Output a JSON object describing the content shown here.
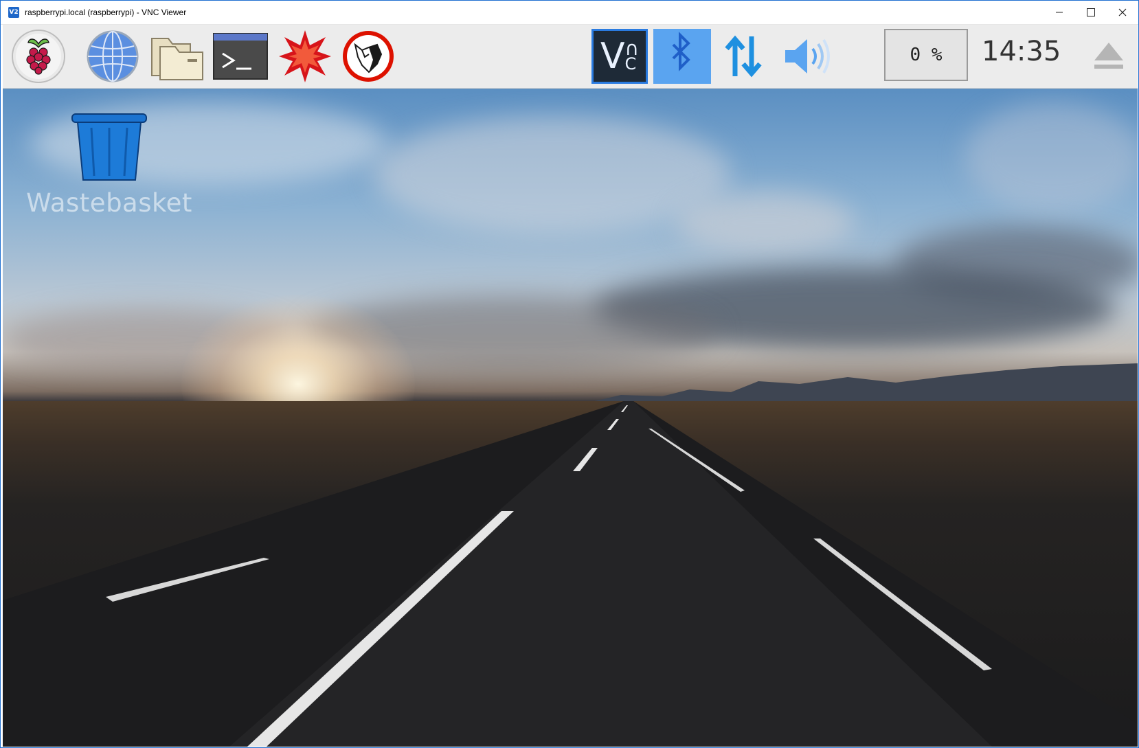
{
  "window": {
    "title": "raspberrypi.local (raspberrypi) - VNC Viewer",
    "app_icon": "V2",
    "controls": {
      "minimize": "minimize-icon",
      "maximize": "maximize-icon",
      "close": "close-icon"
    }
  },
  "taskbar": {
    "launchers": [
      {
        "name": "raspberry-menu",
        "icon": "raspberry-icon"
      },
      {
        "name": "web-browser",
        "icon": "globe-icon"
      },
      {
        "name": "file-manager",
        "icon": "folder-icon"
      },
      {
        "name": "terminal",
        "icon": "terminal-icon"
      },
      {
        "name": "mathematica",
        "icon": "mathematica-icon"
      },
      {
        "name": "wolfram",
        "icon": "wolfram-icon"
      }
    ],
    "tray": {
      "vnc": {
        "icon": "vnc-icon",
        "label": "V",
        "label_sub": "C"
      },
      "bluetooth": {
        "icon": "bluetooth-icon"
      },
      "network": {
        "icon": "network-transfer-icon"
      },
      "volume": {
        "icon": "volume-icon"
      },
      "cpu_usage": "0 %",
      "clock": "14:35",
      "eject": {
        "icon": "eject-icon"
      }
    },
    "colors": {
      "accent": "#2a7be0",
      "tray_highlight": "#5aa4f0"
    }
  },
  "desktop": {
    "icons": [
      {
        "label": "Wastebasket",
        "icon": "wastebasket-icon"
      }
    ]
  }
}
